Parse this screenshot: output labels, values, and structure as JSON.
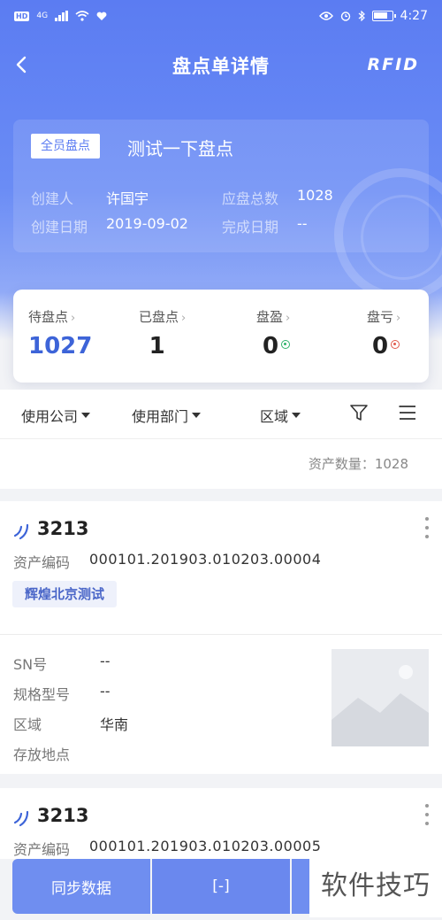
{
  "status_bar": {
    "left_chip": "HD",
    "network": "4G",
    "time": "4:27"
  },
  "navbar": {
    "title": "盘点单详情",
    "rfid_label": "RFID"
  },
  "document": {
    "type_badge": "全员盘点",
    "title": "测试一下盘点",
    "creator_label": "创建人",
    "creator": "许国宇",
    "total_label": "应盘总数",
    "total": "1028",
    "created_date_label": "创建日期",
    "created_date": "2019-09-02",
    "finish_date_label": "完成日期",
    "finish_date": "--"
  },
  "stats": [
    {
      "label": "待盘点",
      "value": "1027"
    },
    {
      "label": "已盘点",
      "value": "1"
    },
    {
      "label": "盘盈",
      "value": "0"
    },
    {
      "label": "盘亏",
      "value": "0"
    }
  ],
  "filters": {
    "company": "使用公司",
    "department": "使用部门",
    "area": "区域"
  },
  "asset_count_text": "资产数量：1028",
  "assets": [
    {
      "number": "3213",
      "code_label": "资产编码",
      "code": "000101.201903.010203.00004",
      "tag": "辉煌北京测试",
      "sn_label": "SN号",
      "sn": "--",
      "model_label": "规格型号",
      "model": "--",
      "area_label": "区域",
      "area": "华南",
      "location_label": "存放地点",
      "location": ""
    },
    {
      "number": "3213",
      "code_label": "资产编码",
      "code": "000101.201903.010203.00005"
    }
  ],
  "bottom_bar": {
    "sync_label": "同步数据",
    "scan_label": "[-]"
  },
  "watermark": "软件技巧",
  "colors": {
    "primary": "#5b7cf2",
    "accent_blue": "#3d64d8",
    "gain_green": "#2fb36b",
    "loss_red": "#e05a4b"
  }
}
